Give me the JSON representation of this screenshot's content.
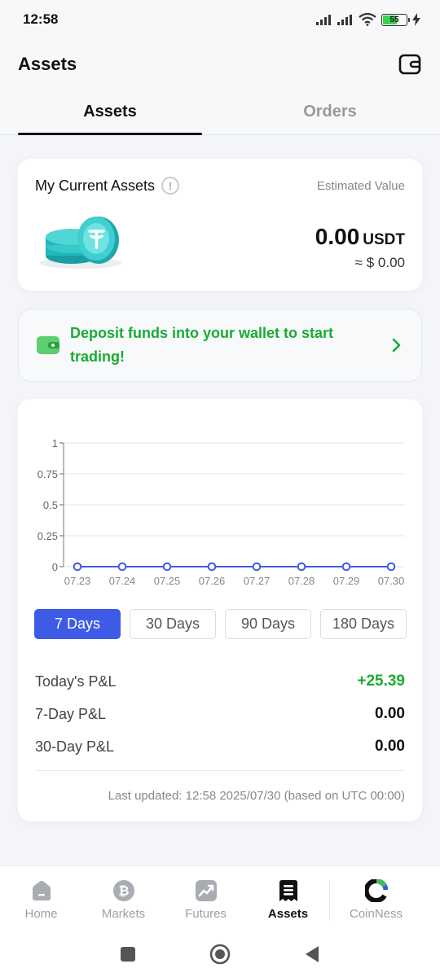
{
  "status_bar": {
    "time": "12:58",
    "battery": "55"
  },
  "header": {
    "title": "Assets",
    "wallet_icon": "wallet-icon"
  },
  "tabs": [
    {
      "label": "Assets",
      "active": true
    },
    {
      "label": "Orders",
      "active": false
    }
  ],
  "assets_card": {
    "label": "My Current Assets",
    "info_symbol": "!",
    "estimated_label": "Estimated Value",
    "amount": "0.00",
    "unit": "USDT",
    "approx": "≈ $ 0.00"
  },
  "deposit": {
    "text_line1": "Deposit funds into your wallet to start",
    "text_line2": "trading!",
    "color": "#1aab33"
  },
  "chart_data": {
    "type": "line",
    "x": [
      "07.23",
      "07.24",
      "07.25",
      "07.26",
      "07.27",
      "07.28",
      "07.29",
      "07.30"
    ],
    "values": [
      0,
      0,
      0,
      0,
      0,
      0,
      0,
      0
    ],
    "ylim": [
      0,
      1
    ],
    "yticks": [
      "1",
      "0.75",
      "0.5",
      "0.25",
      "0"
    ],
    "grid": true,
    "color": "#3e5be7"
  },
  "ranges": [
    {
      "label": "7 Days",
      "active": true
    },
    {
      "label": "30 Days",
      "active": false
    },
    {
      "label": "90 Days",
      "active": false
    },
    {
      "label": "180 Days",
      "active": false
    }
  ],
  "pnl": [
    {
      "label": "Today's P&L",
      "value": "+25.39",
      "positive": true
    },
    {
      "label": "7-Day P&L",
      "value": "0.00",
      "positive": false
    },
    {
      "label": "30-Day P&L",
      "value": "0.00",
      "positive": false
    }
  ],
  "last_updated": "Last updated: 12:58 2025/07/30 (based on UTC 00:00)",
  "bottom_nav": [
    {
      "label": "Home",
      "icon": "home-icon"
    },
    {
      "label": "Markets",
      "icon": "bitcoin-icon"
    },
    {
      "label": "Futures",
      "icon": "chart-icon"
    },
    {
      "label": "Assets",
      "icon": "receipt-icon",
      "active": true
    },
    {
      "label": "CoinNess",
      "icon": "coinness-logo-icon"
    }
  ]
}
